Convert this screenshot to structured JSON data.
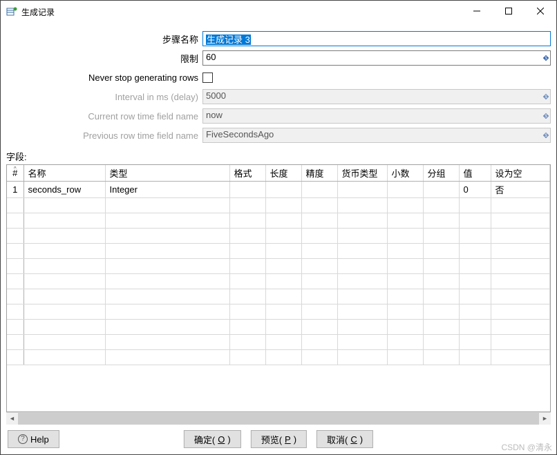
{
  "window": {
    "title": "生成记录"
  },
  "form": {
    "step_name": {
      "label": "步骤名称",
      "value": "生成记录 3"
    },
    "limit": {
      "label": "限制",
      "value": "60"
    },
    "never_stop": {
      "label": "Never stop generating rows",
      "checked": false
    },
    "interval": {
      "label": "Interval in ms (delay)",
      "value": "5000"
    },
    "curr_time": {
      "label": "Current row time field name",
      "value": "now"
    },
    "prev_time": {
      "label": "Previous row time field name",
      "value": "FiveSecondsAgo"
    }
  },
  "fields_section_label": "字段:",
  "table": {
    "headers": {
      "idx": "#",
      "name": "名称",
      "type": "类型",
      "format": "格式",
      "length": "长度",
      "precision": "精度",
      "currency": "货币类型",
      "decimal": "小数",
      "group": "分组",
      "value": "值",
      "set_empty": "设为空"
    },
    "rows": [
      {
        "idx": "1",
        "name": "seconds_row",
        "type": "Integer",
        "format": "",
        "length": "",
        "precision": "",
        "currency": "",
        "decimal": "",
        "group": "",
        "value": "0",
        "set_empty": "否"
      }
    ]
  },
  "buttons": {
    "help": "Help",
    "ok": "确定(",
    "ok_mn": "O",
    "ok_tail": ")",
    "preview": "预览(",
    "preview_mn": "P",
    "preview_tail": ")",
    "cancel": "取消(",
    "cancel_mn": "C",
    "cancel_tail": ")"
  },
  "watermark": "CSDN @清永"
}
